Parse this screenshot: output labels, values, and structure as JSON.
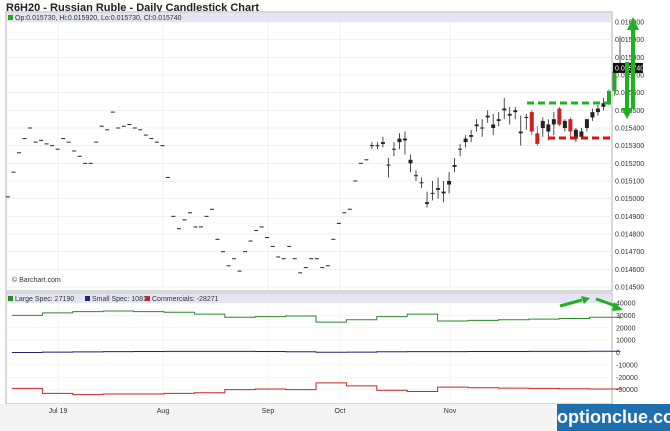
{
  "header": {
    "title": "R6H20 - Russian Ruble - Daily Candlestick Chart"
  },
  "ohlc_legend": "Op:0.015730, Hi:0.015920, Lo:0.015730, Cl:0.015740",
  "last_price_label": "0.015740",
  "copyright": "© Barchart.com",
  "watermark": "optionclue.com",
  "colors": {
    "up": "#2aa52a",
    "down": "#cc2222",
    "neutral": "#222222",
    "large_spec": "#2a8a2a",
    "small_spec": "#22227a",
    "commercials": "#cc2222",
    "annotation_green": "#1fb21f",
    "annotation_red": "#e01010"
  },
  "chart_data": [
    {
      "type": "candlestick",
      "ylim": [
        0.0145,
        0.016
      ],
      "y_ticks": [
        "0.016000",
        "0.015900",
        "0.015800",
        "0.015700",
        "0.015600",
        "0.015500",
        "0.015400",
        "0.015300",
        "0.015200",
        "0.015100",
        "0.015000",
        "0.014900",
        "0.014800",
        "0.014700",
        "0.014600",
        "0.014500"
      ],
      "x_ticks": [
        "Jul 19",
        "Aug",
        "Sep",
        "Oct",
        "Nov"
      ],
      "ohlc": [
        [
          0.01501,
          0.01501,
          0.01501,
          0.01501
        ],
        [
          0.01515,
          0.01515,
          0.01515,
          0.01515
        ],
        [
          0.01526,
          0.01526,
          0.01526,
          0.01526
        ],
        [
          0.01534,
          0.01534,
          0.01534,
          0.01534
        ],
        [
          0.0154,
          0.0154,
          0.0154,
          0.0154
        ],
        [
          0.01532,
          0.01532,
          0.01532,
          0.01532
        ],
        [
          0.01533,
          0.01533,
          0.01533,
          0.01533
        ],
        [
          0.01531,
          0.01531,
          0.01531,
          0.01531
        ],
        [
          0.0153,
          0.0153,
          0.0153,
          0.0153
        ],
        [
          0.01528,
          0.01528,
          0.01528,
          0.01528
        ],
        [
          0.01534,
          0.01534,
          0.01534,
          0.01534
        ],
        [
          0.01532,
          0.01532,
          0.01532,
          0.01532
        ],
        [
          0.01527,
          0.01527,
          0.01527,
          0.01527
        ],
        [
          0.01524,
          0.01524,
          0.01524,
          0.01524
        ],
        [
          0.0152,
          0.0152,
          0.0152,
          0.0152
        ],
        [
          0.0152,
          0.0152,
          0.0152,
          0.0152
        ],
        [
          0.01532,
          0.01532,
          0.01532,
          0.01532
        ],
        [
          0.01541,
          0.01541,
          0.01541,
          0.01541
        ],
        [
          0.01539,
          0.01539,
          0.01539,
          0.01539
        ],
        [
          0.01549,
          0.01549,
          0.01549,
          0.01549
        ],
        [
          0.0154,
          0.0154,
          0.0154,
          0.0154
        ],
        [
          0.01541,
          0.01541,
          0.01541,
          0.01541
        ],
        [
          0.01542,
          0.01542,
          0.01542,
          0.01542
        ],
        [
          0.0154,
          0.0154,
          0.0154,
          0.0154
        ],
        [
          0.01539,
          0.01539,
          0.01539,
          0.01539
        ],
        [
          0.01536,
          0.01536,
          0.01536,
          0.01536
        ],
        [
          0.01534,
          0.01534,
          0.01534,
          0.01534
        ],
        [
          0.01532,
          0.01532,
          0.01532,
          0.01532
        ],
        [
          0.0153,
          0.0153,
          0.0153,
          0.0153
        ],
        [
          0.01512,
          0.01512,
          0.01512,
          0.01512
        ],
        [
          0.0149,
          0.0149,
          0.0149,
          0.0149
        ],
        [
          0.01483,
          0.01483,
          0.01483,
          0.01483
        ],
        [
          0.01488,
          0.01488,
          0.01488,
          0.01488
        ],
        [
          0.01492,
          0.01492,
          0.01492,
          0.01492
        ],
        [
          0.01484,
          0.01484,
          0.01484,
          0.01484
        ],
        [
          0.01484,
          0.01484,
          0.01484,
          0.01484
        ],
        [
          0.0149,
          0.0149,
          0.0149,
          0.0149
        ],
        [
          0.01494,
          0.01494,
          0.01494,
          0.01494
        ],
        [
          0.01477,
          0.01477,
          0.01477,
          0.01477
        ],
        [
          0.0147,
          0.0147,
          0.0147,
          0.0147
        ],
        [
          0.01462,
          0.01462,
          0.01462,
          0.01462
        ],
        [
          0.01466,
          0.01466,
          0.01466,
          0.01466
        ],
        [
          0.01459,
          0.01459,
          0.01459,
          0.01459
        ],
        [
          0.0147,
          0.0147,
          0.0147,
          0.0147
        ],
        [
          0.01476,
          0.01476,
          0.01476,
          0.01476
        ],
        [
          0.01482,
          0.01482,
          0.01482,
          0.01482
        ],
        [
          0.01484,
          0.01484,
          0.01484,
          0.01484
        ],
        [
          0.01478,
          0.01478,
          0.01478,
          0.01478
        ],
        [
          0.01473,
          0.01473,
          0.01473,
          0.01473
        ],
        [
          0.01467,
          0.01467,
          0.01467,
          0.01467
        ],
        [
          0.01466,
          0.01466,
          0.01466,
          0.01466
        ],
        [
          0.01473,
          0.01473,
          0.01473,
          0.01473
        ],
        [
          0.01466,
          0.01466,
          0.01466,
          0.01466
        ],
        [
          0.01458,
          0.01458,
          0.01458,
          0.01458
        ],
        [
          0.01461,
          0.01461,
          0.01461,
          0.01461
        ],
        [
          0.01466,
          0.01466,
          0.01466,
          0.01466
        ],
        [
          0.01466,
          0.01466,
          0.01466,
          0.01466
        ],
        [
          0.01461,
          0.01461,
          0.01461,
          0.01461
        ],
        [
          0.01462,
          0.01462,
          0.01462,
          0.01462
        ],
        [
          0.01477,
          0.01477,
          0.01477,
          0.01477
        ],
        [
          0.01486,
          0.01486,
          0.01486,
          0.01486
        ],
        [
          0.01492,
          0.01492,
          0.01492,
          0.01492
        ],
        [
          0.01494,
          0.01494,
          0.01494,
          0.01494
        ],
        [
          0.0151,
          0.0151,
          0.0151,
          0.0151
        ],
        [
          0.0152,
          0.0152,
          0.0152,
          0.0152
        ],
        [
          0.01522,
          0.01522,
          0.01522,
          0.01522
        ],
        [
          0.0153,
          0.01532,
          0.01528,
          0.0153
        ],
        [
          0.0153,
          0.01532,
          0.01528,
          0.0153
        ],
        [
          0.01532,
          0.01535,
          0.01529,
          0.01531
        ],
        [
          0.01519,
          0.01523,
          0.01512,
          0.01519
        ],
        [
          0.01528,
          0.01532,
          0.01524,
          0.01528
        ],
        [
          0.01534,
          0.01537,
          0.01528,
          0.01532
        ],
        [
          0.01534,
          0.01538,
          0.01525,
          0.01533
        ],
        [
          0.01522,
          0.01525,
          0.01515,
          0.0152
        ],
        [
          0.01513,
          0.01516,
          0.0151,
          0.01513
        ],
        [
          0.01509,
          0.01512,
          0.01506,
          0.01509
        ],
        [
          0.01497,
          0.01504,
          0.01495,
          0.01498
        ],
        [
          0.01503,
          0.0151,
          0.01499,
          0.01503
        ],
        [
          0.01506,
          0.01512,
          0.015,
          0.01505
        ],
        [
          0.01504,
          0.0151,
          0.01498,
          0.01503
        ],
        [
          0.0151,
          0.01515,
          0.01503,
          0.01508
        ],
        [
          0.01519,
          0.01523,
          0.01515,
          0.01518
        ],
        [
          0.01528,
          0.01531,
          0.01524,
          0.01528
        ],
        [
          0.01532,
          0.01536,
          0.01529,
          0.01534
        ],
        [
          0.01535,
          0.01539,
          0.01532,
          0.01536
        ],
        [
          0.01541,
          0.01545,
          0.01538,
          0.01542
        ],
        [
          0.0154,
          0.01545,
          0.01535,
          0.0154
        ],
        [
          0.01547,
          0.0155,
          0.01543,
          0.01546
        ],
        [
          0.0154,
          0.01548,
          0.01536,
          0.01542
        ],
        [
          0.01545,
          0.01549,
          0.01541,
          0.01544
        ],
        [
          0.0155,
          0.01557,
          0.01545,
          0.01551
        ],
        [
          0.01547,
          0.01552,
          0.01542,
          0.01548
        ],
        [
          0.01549,
          0.01552,
          0.01545,
          0.0155
        ],
        [
          0.01537,
          0.01547,
          0.0153,
          0.01538
        ],
        [
          0.01546,
          0.01548,
          0.01539,
          0.01546
        ],
        [
          0.01549,
          0.0155,
          0.01536,
          0.01538
        ],
        [
          0.01537,
          0.01541,
          0.0153,
          0.01531
        ],
        [
          0.0154,
          0.01546,
          0.01535,
          0.01544
        ],
        [
          0.01542,
          0.01545,
          0.01533,
          0.01538
        ],
        [
          0.01545,
          0.01549,
          0.01536,
          0.01542
        ],
        [
          0.01551,
          0.01552,
          0.01541,
          0.01542
        ],
        [
          0.0154,
          0.01545,
          0.01538,
          0.01544
        ],
        [
          0.01545,
          0.01546,
          0.01535,
          0.01538
        ],
        [
          0.01539,
          0.0154,
          0.01532,
          0.01534
        ],
        [
          0.01535,
          0.0154,
          0.01534,
          0.01538
        ],
        [
          0.0154,
          0.01545,
          0.01538,
          0.01545
        ],
        [
          0.01546,
          0.01551,
          0.01544,
          0.01549
        ],
        [
          0.01549,
          0.01553,
          0.01547,
          0.01551
        ],
        [
          0.01552,
          0.01557,
          0.0155,
          0.01554
        ],
        [
          0.01555,
          0.01562,
          0.01553,
          0.01561
        ],
        [
          0.01561,
          0.01574,
          0.01558,
          0.01572
        ],
        [
          0.01573,
          0.01592,
          0.01573,
          0.01574
        ]
      ]
    },
    {
      "type": "line",
      "ylim": [
        -40000,
        40000
      ],
      "y_ticks": [
        "40000",
        "30000",
        "20000",
        "10000",
        "0",
        "-10000",
        "-20000",
        "-30000"
      ],
      "x_ticks": [
        "Jul 19",
        "Aug",
        "Sep",
        "Oct",
        "Nov"
      ],
      "series": [
        {
          "name": "Large Spec: 27190",
          "values": [
            30000,
            32000,
            33000,
            33500,
            33000,
            32500,
            31000,
            28500,
            29000,
            29500,
            24500,
            26500,
            29000,
            31000,
            25500,
            26000,
            26500,
            27000,
            27500,
            28500,
            27190
          ]
        },
        {
          "name": "Small Spec: 1081",
          "values": [
            0,
            300,
            500,
            700,
            800,
            900,
            950,
            900,
            800,
            600,
            200,
            350,
            600,
            700,
            750,
            800,
            850,
            900,
            950,
            1000,
            1081
          ]
        },
        {
          "name": "Commercials: -28271",
          "values": [
            -29000,
            -33000,
            -34000,
            -33500,
            -33500,
            -33000,
            -32500,
            -30000,
            -29500,
            -30000,
            -24500,
            -27000,
            -30500,
            -31500,
            -28000,
            -28500,
            -28800,
            -29000,
            -29300,
            -29500,
            -28271
          ]
        }
      ]
    }
  ]
}
